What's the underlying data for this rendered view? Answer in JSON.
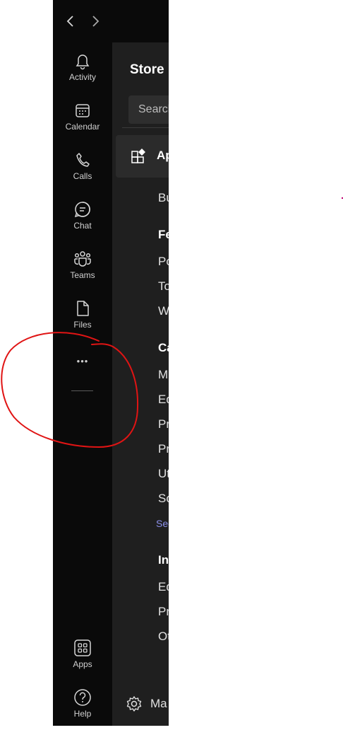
{
  "rail": {
    "items": [
      {
        "label": "Activity",
        "icon": "bell-icon"
      },
      {
        "label": "Calendar",
        "icon": "calendar-icon"
      },
      {
        "label": "Calls",
        "icon": "phone-icon"
      },
      {
        "label": "Chat",
        "icon": "chat-icon"
      },
      {
        "label": "Teams",
        "icon": "teams-icon"
      },
      {
        "label": "Files",
        "icon": "file-icon"
      }
    ],
    "more": "•••",
    "apps": "Apps",
    "help": "Help"
  },
  "panel": {
    "title": "Store",
    "search_text": "Search",
    "apps_row_label": "Ap",
    "lines": [
      "Bu",
      "Po",
      "To",
      "W",
      "M",
      "Ed",
      "Pr",
      "Pr",
      "Ut",
      "So",
      "Ed",
      "Pr",
      "Ot"
    ],
    "headings": [
      "Fe",
      "Ca",
      "In"
    ],
    "see_more": "See",
    "manage": "Ma"
  },
  "colors": {
    "rail_bg": "#0a0a0a",
    "panel_bg": "#1f1f1f",
    "link": "#8b8fe8",
    "annotation": "#e01414"
  }
}
